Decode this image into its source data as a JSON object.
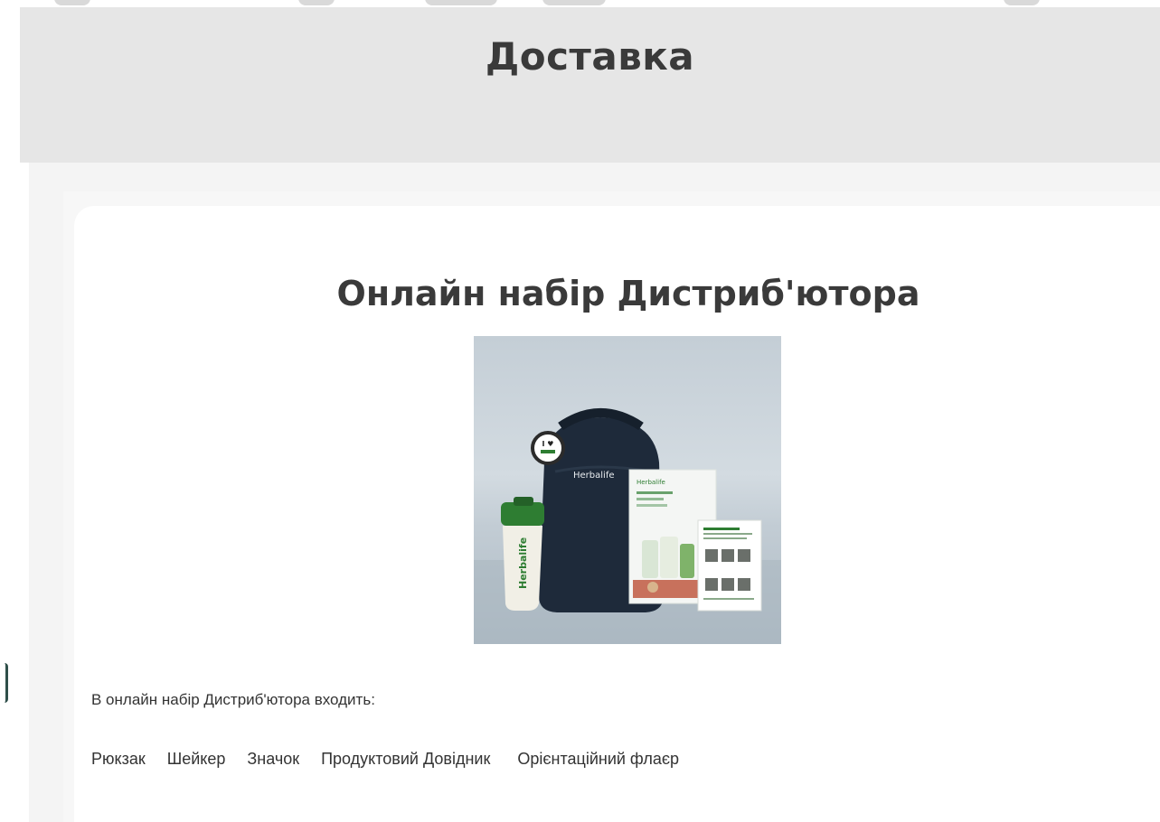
{
  "page": {
    "title": "Доставка"
  },
  "card": {
    "title": "Онлайн набір Дистриб'ютора",
    "image_alt_icon": "distributor-kit-image",
    "description": "В онлайн набір Дистриб'ютора входить:",
    "items": [
      "Рюкзак",
      "Шейкер",
      "Значок",
      "Продуктовий Довідник",
      "Орієнтаційний флаєр"
    ]
  },
  "image_text": {
    "backpack_brand": "Herbalife",
    "shaker_brand": "Herbalife",
    "guide_brand": "Herbalife"
  },
  "colors": {
    "header_bg": "#e6e6e6",
    "title_text": "#3a3a3a",
    "card_bg": "#ffffff",
    "brand_green": "#2e7d32"
  }
}
